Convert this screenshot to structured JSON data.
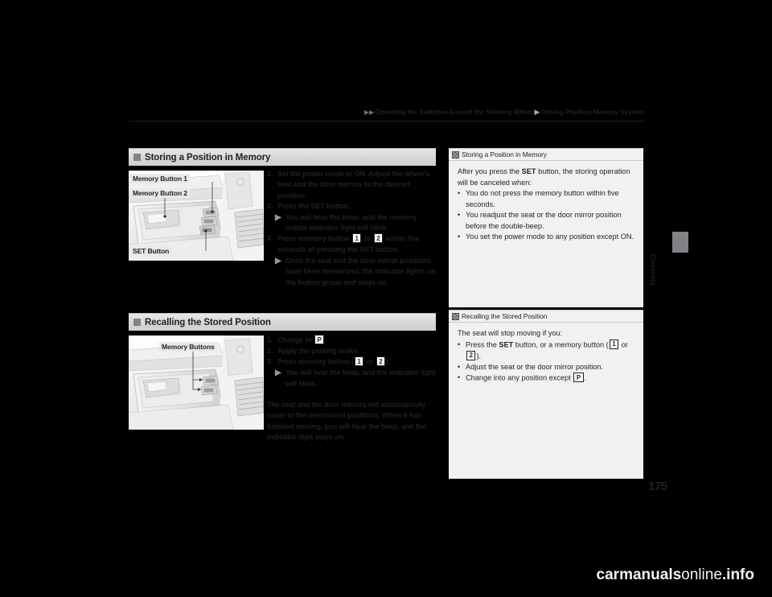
{
  "header": {
    "breadcrumb_1": "Operating the Switches Around the Steering Wheel",
    "breadcrumb_2": "Driving Position Memory System",
    "arrow_glyph": "▶"
  },
  "thumb_tab": {
    "label": "Controls"
  },
  "page_number": "175",
  "sections": [
    {
      "id": "storing",
      "heading": "Storing a Position in Memory",
      "illustration": {
        "name": "door-panel-memory-buttons",
        "callouts": [
          {
            "label": "Memory Button 1"
          },
          {
            "label": "Memory Button 2"
          },
          {
            "label": "SET Button"
          }
        ]
      },
      "steps": [
        {
          "num": "1.",
          "text_before": "Set the power mode to ON. Adjust the driver's seat and the door mirrors to the desired position.",
          "notes": []
        },
        {
          "num": "2.",
          "text_before": "Press the SET button.",
          "notes": [
            {
              "text": "You will hear the beep, and the memory button indicator light will blink."
            }
          ]
        },
        {
          "num": "3.",
          "text_before": "Press memory button ",
          "box_a": "1",
          "mid": " or ",
          "box_b": "2",
          "text_after": " within five seconds of pressing the SET button.",
          "notes": [
            {
              "text": "Once the seat and the door mirror positions have been memorized, the indicator lights on the button group and stays on."
            }
          ]
        }
      ]
    },
    {
      "id": "recalling",
      "heading": "Recalling the Stored Position",
      "illustration": {
        "name": "door-panel-memory-buttons",
        "callouts": [
          {
            "label": "Memory Buttons"
          }
        ]
      },
      "steps": [
        {
          "num": "1.",
          "text_before": "Change to ",
          "box_a": "P",
          "text_after": ".",
          "notes": []
        },
        {
          "num": "2.",
          "text_before": "Apply the parking brake.",
          "notes": []
        },
        {
          "num": "3.",
          "text_before": "Press memory button (",
          "box_a": "1",
          "mid": " or ",
          "box_b": "2",
          "text_after": ").",
          "notes": [
            {
              "text": "You will hear the beep, and the indicator light will blink."
            }
          ]
        }
      ],
      "paragraph": "The seat and the door mirrors will automatically move to the memorized positions. When it has finished moving, you will hear the beep, and the indicator light stays on."
    }
  ],
  "notes": [
    {
      "id": "note-storing",
      "title": "Storing a Position in Memory",
      "intro_a": "After you press the ",
      "intro_bold": "SET",
      "intro_b": " button, the storing operation will be canceled when:",
      "bullets": [
        "You do not press the memory button within five seconds.",
        "You readjust the seat or the door mirror position before the double-beep.",
        "You set the power mode to any position except ON."
      ]
    },
    {
      "id": "note-recalling",
      "title": "Recalling the Stored Position",
      "intro": "The seat will stop moving if you:",
      "bullet_1_a": "Press the ",
      "bullet_1_bold": "SET",
      "bullet_1_b": " button, or a memory button (",
      "bullet_1_box_a": "1",
      "bullet_1_mid": " or ",
      "bullet_1_box_b": "2",
      "bullet_1_c": ").",
      "bullet_2": "Adjust the seat or the door mirror position.",
      "bullet_3_a": "Change into any position except ",
      "bullet_3_box": "P",
      "bullet_3_b": "."
    }
  ],
  "watermark": {
    "text_strong": "carmanuals",
    "text_normal": "online",
    "text_suffix": ".info"
  }
}
